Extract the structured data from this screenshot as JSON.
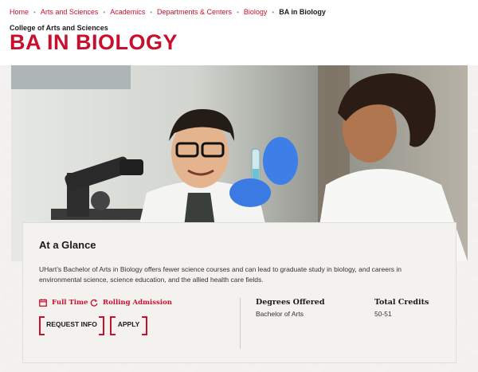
{
  "breadcrumb": {
    "items": [
      "Home",
      "Arts and Sciences",
      "Academics",
      "Departments & Centers",
      "Biology"
    ],
    "current": "BA in Biology"
  },
  "header": {
    "college": "College of Arts and Sciences",
    "title": "BA IN BIOLOGY"
  },
  "hero": {
    "image_subject": "two students in lab coats with a microscope and test tube"
  },
  "glance": {
    "heading": "At a Glance",
    "description": "UHart’s Bachelor of Arts in Biology offers fewer science courses and can lead to graduate study in biology, and careers in environmental science, science education, and the allied health care fields.",
    "features": [
      {
        "icon": "calendar-icon",
        "label": "Full Time"
      },
      {
        "icon": "refresh-icon",
        "label": "Rolling Admission"
      }
    ],
    "buttons": {
      "request": "REQUEST INFO",
      "apply": "APPLY"
    },
    "degrees": {
      "label": "Degrees Offered",
      "value": "Bachelor of Arts"
    },
    "credits": {
      "label": "Total Credits",
      "value": "50-51"
    }
  },
  "colors": {
    "accent": "#c8102e",
    "background": "#f2f1ef",
    "card": "#f4f2ef"
  }
}
